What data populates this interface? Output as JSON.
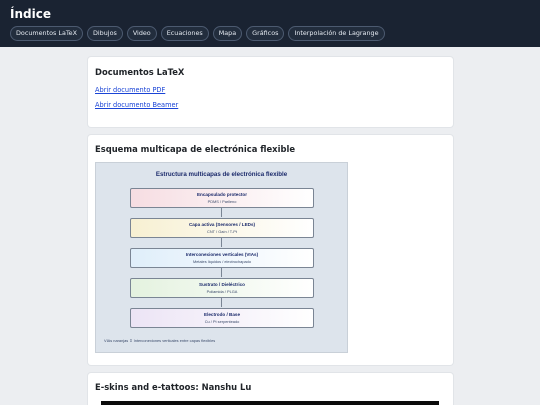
{
  "header": {
    "title": "Índice",
    "nav": [
      {
        "label": "Documentos LaTeX"
      },
      {
        "label": "Dibujos"
      },
      {
        "label": "Video"
      },
      {
        "label": "Ecuaciones"
      },
      {
        "label": "Mapa"
      },
      {
        "label": "Gráficos"
      },
      {
        "label": "Interpolación de Lagrange"
      }
    ]
  },
  "latex": {
    "title": "Documentos LaTeX",
    "links": [
      {
        "label": "Abrir documento PDF"
      },
      {
        "label": "Abrir documento Beamer"
      }
    ]
  },
  "scheme": {
    "title": "Esquema multicapa de electrónica flexible",
    "diagram": {
      "title": "Estructura multicapas de electrónica flexible",
      "layers": [
        {
          "name": "Encapsulado protector",
          "sub": "PDMS / Parileno",
          "color": "#f6dde2"
        },
        {
          "name": "Capa activa (Sensores / LEDs)",
          "sub": "CNT / Gaín / T-Pt",
          "color": "#f7f0d2"
        },
        {
          "name": "Interconexiones verticales (VIAs)",
          "sub": "Metales líquidos / electrochapado",
          "color": "#dfeefa"
        },
        {
          "name": "Sustrato / Dieléctrico",
          "sub": "Poliamida / PLGA",
          "color": "#e4f2df"
        },
        {
          "name": "Electrodo / Base",
          "sub": "Cu / Pt serpenteado",
          "color": "#ece4f5"
        }
      ],
      "note": "VIAs naranjas ⇕ Interconexiones verticales entre capas flexibles"
    }
  },
  "eskins": {
    "title": "E-skins and e-tattoos: Nanshu Lu"
  }
}
